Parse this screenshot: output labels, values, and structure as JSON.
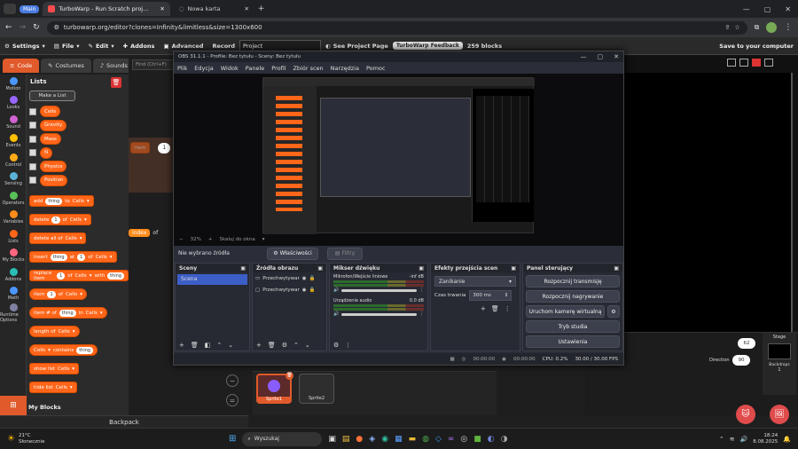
{
  "browser": {
    "tabs": [
      {
        "label": "Main",
        "type": "badge"
      },
      {
        "label": "TurboWarp - Run Scratch proj..."
      },
      {
        "label": "Nowa karta"
      }
    ],
    "url": "turbowarp.org/editor?clones=Infinity&limitless&size=1300x600"
  },
  "tw": {
    "menu": {
      "settings": "Settings",
      "file": "File",
      "edit": "Edit",
      "addons": "Addons",
      "advanced": "Advanced",
      "record": "Record",
      "project_title": "Project",
      "see_project_page": "See Project Page",
      "feedback": "TurboWarp Feedback",
      "blocks_count": "259 blocks",
      "save": "Save to your computer"
    },
    "tabs": {
      "code": "Code",
      "costumes": "Costumes",
      "sounds": "Sounds"
    },
    "find_placeholder": "Find (Ctrl+F)",
    "categories": [
      {
        "label": "Motion",
        "color": "#4c97ff"
      },
      {
        "label": "Looks",
        "color": "#9966ff"
      },
      {
        "label": "Sound",
        "color": "#cf63cf"
      },
      {
        "label": "Events",
        "color": "#ffbf00"
      },
      {
        "label": "Control",
        "color": "#ffab19"
      },
      {
        "label": "Sensing",
        "color": "#5cb1d6"
      },
      {
        "label": "Operators",
        "color": "#59c059"
      },
      {
        "label": "Variables",
        "color": "#ff8c1a"
      },
      {
        "label": "Lists",
        "color": "#ff661a"
      },
      {
        "label": "My Blocks",
        "color": "#ff6680"
      },
      {
        "label": "Addons",
        "color": "#29beb8"
      },
      {
        "label": "Math",
        "color": "#4c97ff"
      },
      {
        "label": "Runtime Options",
        "color": "#8080a0"
      }
    ],
    "palette": {
      "heading": "Lists",
      "make_list": "Make a List",
      "lists": [
        "Cells",
        "Gravity",
        "Mass",
        "N",
        "Physics",
        "Position"
      ],
      "blocks": [
        {
          "pre": "add",
          "arg": "thing",
          "mid": "to",
          "list": "Cells"
        },
        {
          "pre": "delete",
          "arg": "1",
          "mid": "of",
          "list": "Cells"
        },
        {
          "pre": "delete all of",
          "list": "Cells"
        },
        {
          "pre": "insert",
          "arg": "thing",
          "mid": "at",
          "arg2": "1",
          "mid2": "of",
          "list": "Cells"
        },
        {
          "pre": "replace item",
          "arg": "1",
          "mid": "of",
          "list": "Cells",
          "post": "with",
          "arg3": "thing"
        },
        {
          "pre": "item",
          "arg": "1",
          "mid": "of",
          "list": "Cells"
        },
        {
          "pre": "item # of",
          "arg": "thing",
          "mid": "in",
          "list": "Cells"
        },
        {
          "pre": "length of",
          "list": "Cells"
        },
        {
          "pre": "",
          "list": "Cells",
          "post": "contains",
          "arg3": "thing"
        },
        {
          "pre": "show list",
          "list": "Cells"
        },
        {
          "pre": "hide list",
          "list": "Cells"
        }
      ],
      "my_blocks": "My Blocks"
    },
    "script_blocks": {
      "item": "item",
      "of": "of",
      "one": "1",
      "index": "index",
      "of2": "of"
    },
    "backpack": "Backpack",
    "stage": {
      "x_value": "62",
      "direction_label": "Direction",
      "direction_value": "90",
      "stage_label": "Stage",
      "backdrops_label": "Backdrops",
      "backdrops_count": "1"
    },
    "sprites": [
      {
        "name": "Sprite1"
      },
      {
        "name": "Sprite2"
      }
    ]
  },
  "obs": {
    "title": "OBS 31.1.1 - Profile: Bez tytułu - Sceny: Bez tytułu",
    "menu": [
      "Plik",
      "Edycja",
      "Widok",
      "Panele",
      "Profil",
      "Zbiór scen",
      "Narzędzia",
      "Pomoc"
    ],
    "zoom": "32%",
    "scale_mode": "Skaluj do okna",
    "no_source": "Nie wybrano źródła",
    "properties": "Właściwości",
    "filters": "Filtry",
    "docks": {
      "scenes": {
        "title": "Sceny",
        "items": [
          "Scena"
        ]
      },
      "sources": {
        "title": "Źródła obrazu",
        "items": [
          "Przechwytywar",
          "Przechwytywar"
        ]
      },
      "mixer": {
        "title": "Mikser dźwięku",
        "ch1": "Mikrofon/Wejście liniowe",
        "ch1_db": "-inf dB",
        "ch2": "Urządzenie audio",
        "ch2_db": "0.0 dB"
      },
      "transitions": {
        "title": "Efekty przejścia scen",
        "type": "Zanikanie",
        "duration_label": "Czas trwania",
        "duration": "300 ms"
      },
      "controls": {
        "title": "Panel sterujący",
        "start_stream": "Rozpocznij transmisję",
        "start_record": "Rozpocznij nagrywanie",
        "virtual_cam": "Uruchom kamerę wirtualną",
        "studio": "Tryb studia",
        "settings": "Ustawienia"
      }
    },
    "status": {
      "t1": "00:00:00",
      "t2": "00:00:00",
      "cpu": "CPU: 0.2%",
      "fps": "30.00 / 30.00 FPS"
    }
  },
  "taskbar": {
    "temp": "21°C",
    "weather": "Słonecznie",
    "search": "Wyszukaj",
    "time": "18:24",
    "date": "8.08.2025"
  }
}
